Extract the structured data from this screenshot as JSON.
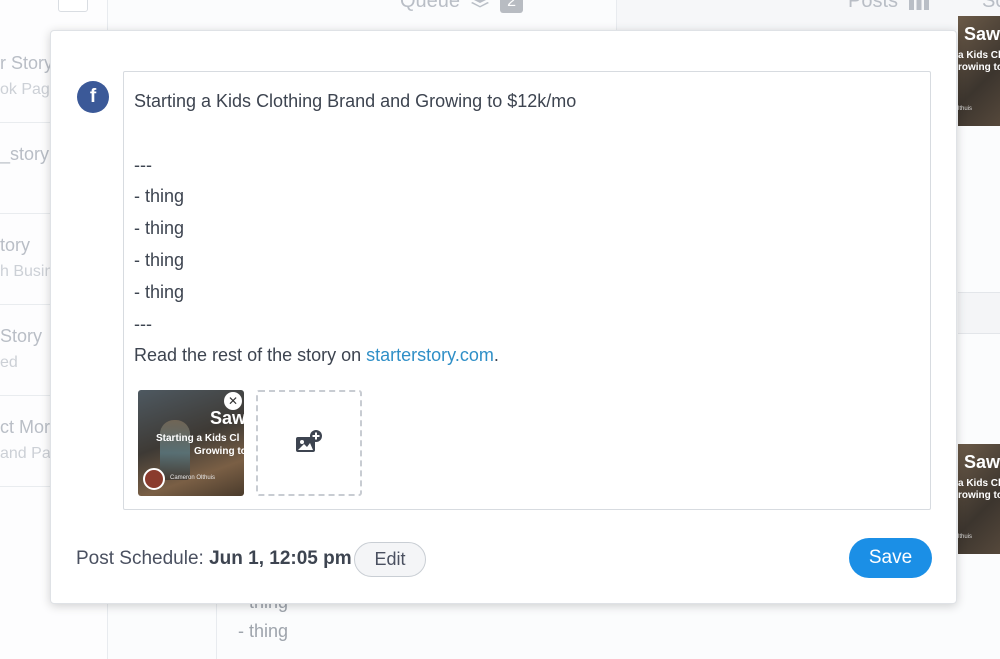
{
  "background": {
    "tabs": {
      "queue_label": "Queue",
      "queue_count": "2",
      "posts_label": "Posts",
      "s_label": "So"
    },
    "left_items": [
      {
        "title": "r Story",
        "sub": "ok Page"
      },
      {
        "title": "_story",
        "sub": ""
      },
      {
        "title": "tory",
        "sub": "h Busin"
      },
      {
        "title": "Story",
        "sub": "ed"
      },
      {
        "title": "ct Mor",
        "sub": "and Pa"
      }
    ],
    "below_lines": [
      "- thing",
      "- thing"
    ],
    "right_thumbs": [
      {
        "big": "Saw",
        "line1": "a Kids Cl",
        "line2": "rowing to",
        "author": "lthuis"
      },
      {
        "big": "Saw",
        "line1": "a Kids Cl",
        "line2": "rowing to",
        "author": "lthuis"
      }
    ]
  },
  "modal": {
    "network_icon": "facebook-icon",
    "post": {
      "title_line": "Starting a Kids Clothing Brand and Growing to $12k/mo",
      "blank": "",
      "sep1": "---",
      "items": [
        "- thing",
        "- thing",
        "- thing",
        "- thing"
      ],
      "sep2": "---",
      "read_prefix": "Read the rest of the story on ",
      "read_link": "starterstory.com",
      "read_suffix": "."
    },
    "attachment": {
      "big": "Saw",
      "line1": "Starting a Kids Cl",
      "line2": "Growing to",
      "author": "Cameron Olthuis",
      "remove_icon": "close-icon"
    },
    "add_media_icon": "add-image-icon",
    "schedule_label": "Post Schedule: ",
    "schedule_value": "Jun 1, 12:05 pm",
    "edit_label": "Edit",
    "save_label": "Save"
  },
  "colors": {
    "facebook": "#3b5998",
    "primary": "#1b8fe6",
    "link": "#2f8fc7"
  }
}
